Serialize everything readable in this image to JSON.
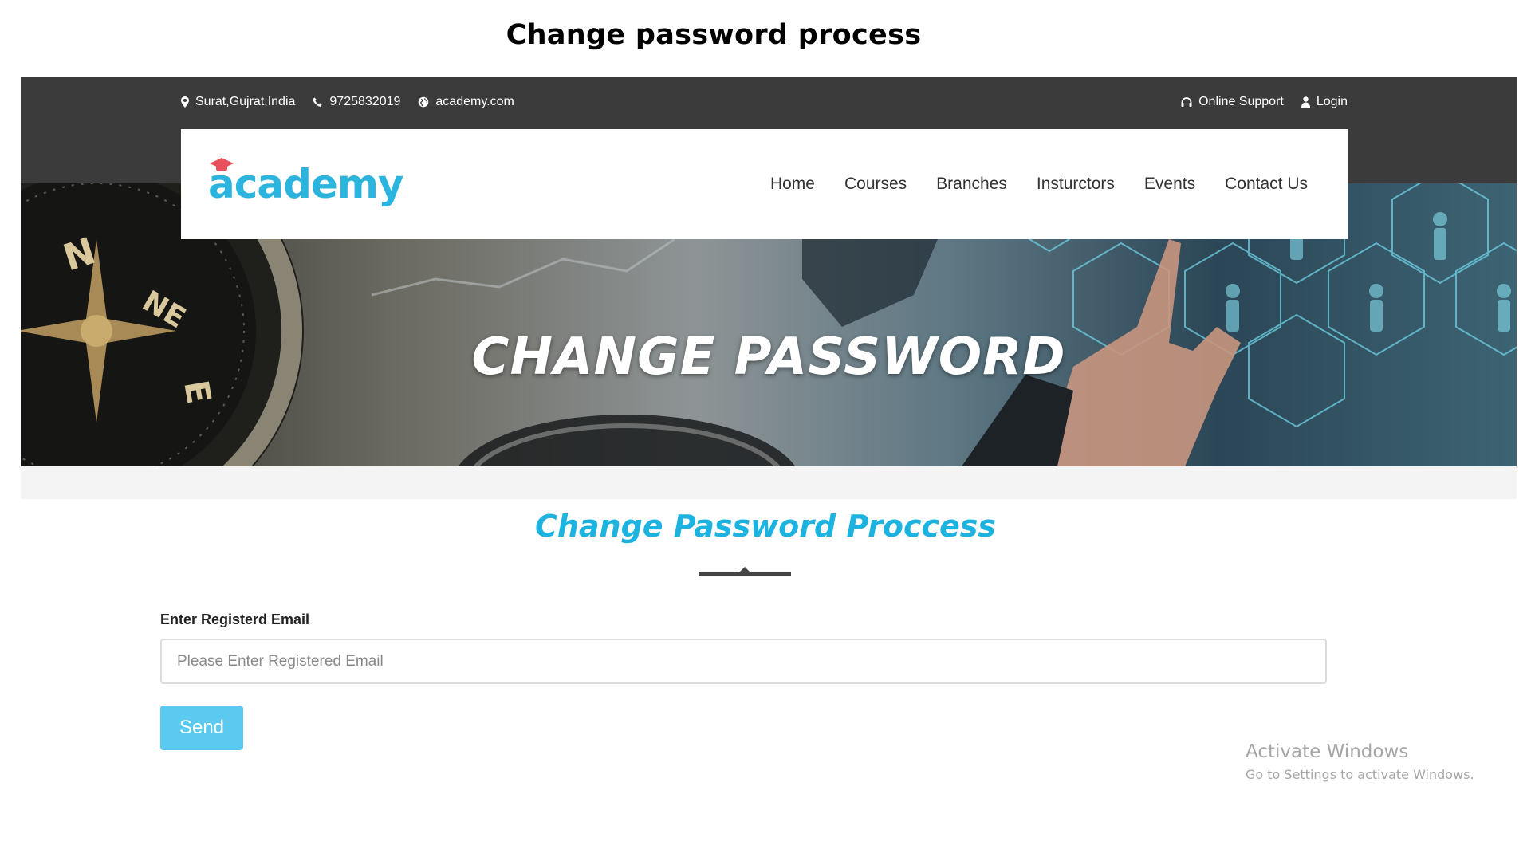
{
  "caption": "Change password process",
  "topbar": {
    "location": "Surat,Gujrat,India",
    "phone": "9725832019",
    "website": "academy.com",
    "online_support": "Online Support",
    "login": "Login",
    "icons": [
      "map-marker-icon",
      "phone-icon",
      "globe-icon",
      "headset-icon",
      "user-icon"
    ]
  },
  "navbar": {
    "logo_text": "academy",
    "links": [
      "Home",
      "Courses",
      "Branches",
      "Insturctors",
      "Events",
      "Contact Us"
    ]
  },
  "hero": {
    "title": "CHANGE PASSWORD"
  },
  "form": {
    "section_title": "Change Password Proccess",
    "email_label": "Enter Registerd Email",
    "email_placeholder": "Please Enter Registered Email",
    "email_value": "",
    "send_label": "Send"
  },
  "watermark": {
    "title": "Activate Windows",
    "subtitle": "Go to Settings to activate Windows."
  },
  "colors": {
    "topbar_bg": "#3b3b3b",
    "accent": "#1cb3e0",
    "button": "#5bcaf0",
    "logo_cap": "#e8505b"
  }
}
